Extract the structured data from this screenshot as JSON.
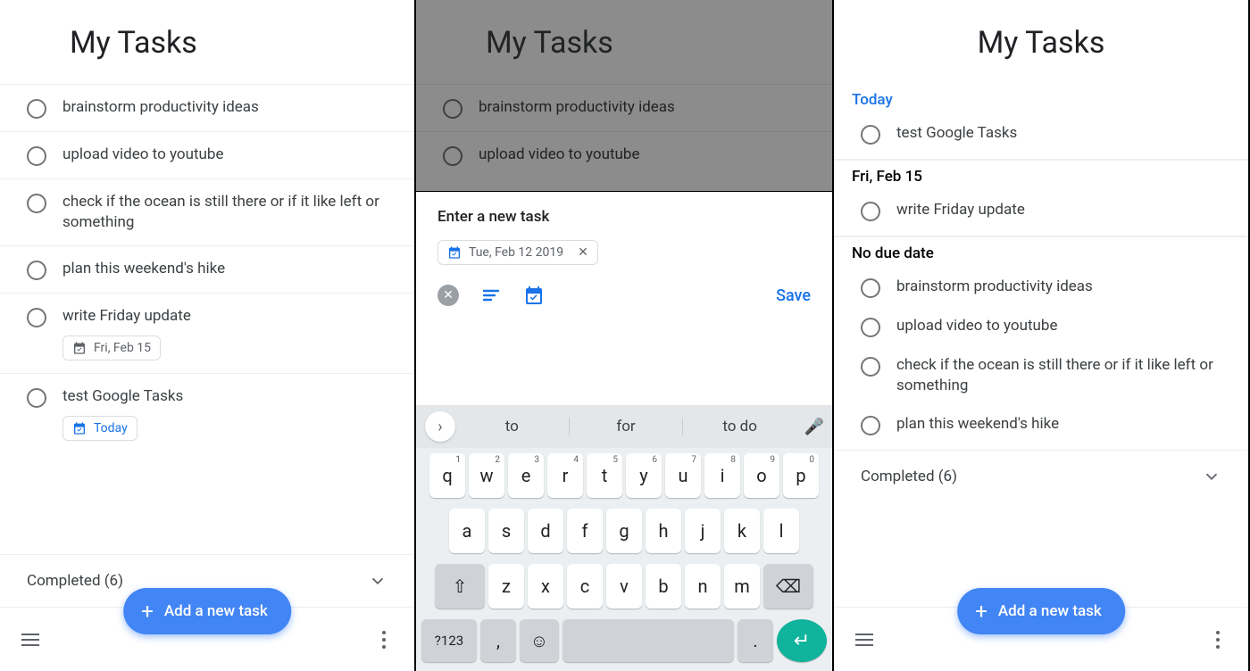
{
  "shared": {
    "title": "My Tasks",
    "add_label": "Add a new task",
    "completed_label": "Completed (6)"
  },
  "screen1": {
    "tasks": [
      {
        "text": "brainstorm productivity ideas"
      },
      {
        "text": "upload video to youtube"
      },
      {
        "text": "check if the ocean is still there or if it like left or something"
      },
      {
        "text": "plan this weekend's hike"
      },
      {
        "text": "write Friday update",
        "chip": "Fri, Feb 15",
        "chip_style": "grey"
      },
      {
        "text": "test Google Tasks",
        "chip": "Today",
        "chip_style": "blue"
      }
    ]
  },
  "screen2": {
    "behind_tasks": [
      {
        "text": "brainstorm productivity ideas"
      },
      {
        "text": "upload video to youtube"
      }
    ],
    "input_placeholder": "Enter a new task",
    "date_chip": "Tue, Feb 12 2019",
    "save_label": "Save",
    "suggestions": [
      "to",
      "for",
      "to do"
    ],
    "kb_rows": {
      "r1": [
        {
          "k": "q",
          "n": "1"
        },
        {
          "k": "w",
          "n": "2"
        },
        {
          "k": "e",
          "n": "3"
        },
        {
          "k": "r",
          "n": "4"
        },
        {
          "k": "t",
          "n": "5"
        },
        {
          "k": "y",
          "n": "6"
        },
        {
          "k": "u",
          "n": "7"
        },
        {
          "k": "i",
          "n": "8"
        },
        {
          "k": "o",
          "n": "9"
        },
        {
          "k": "p",
          "n": "0"
        }
      ],
      "r2": [
        "a",
        "s",
        "d",
        "f",
        "g",
        "h",
        "j",
        "k",
        "l"
      ],
      "r3": [
        "z",
        "x",
        "c",
        "v",
        "b",
        "n",
        "m"
      ]
    },
    "sym_label": "?123"
  },
  "screen3": {
    "groups": [
      {
        "title": "Today",
        "title_style": "blue",
        "tasks": [
          {
            "text": "test Google Tasks"
          }
        ]
      },
      {
        "title": "Fri, Feb 15",
        "title_style": "",
        "tasks": [
          {
            "text": "write Friday update"
          }
        ]
      },
      {
        "title": "No due date",
        "title_style": "",
        "tasks": [
          {
            "text": "brainstorm productivity ideas"
          },
          {
            "text": "upload video to youtube"
          },
          {
            "text": "check if the ocean is still there or if it like left or something"
          },
          {
            "text": "plan this weekend's hike"
          }
        ]
      }
    ]
  }
}
